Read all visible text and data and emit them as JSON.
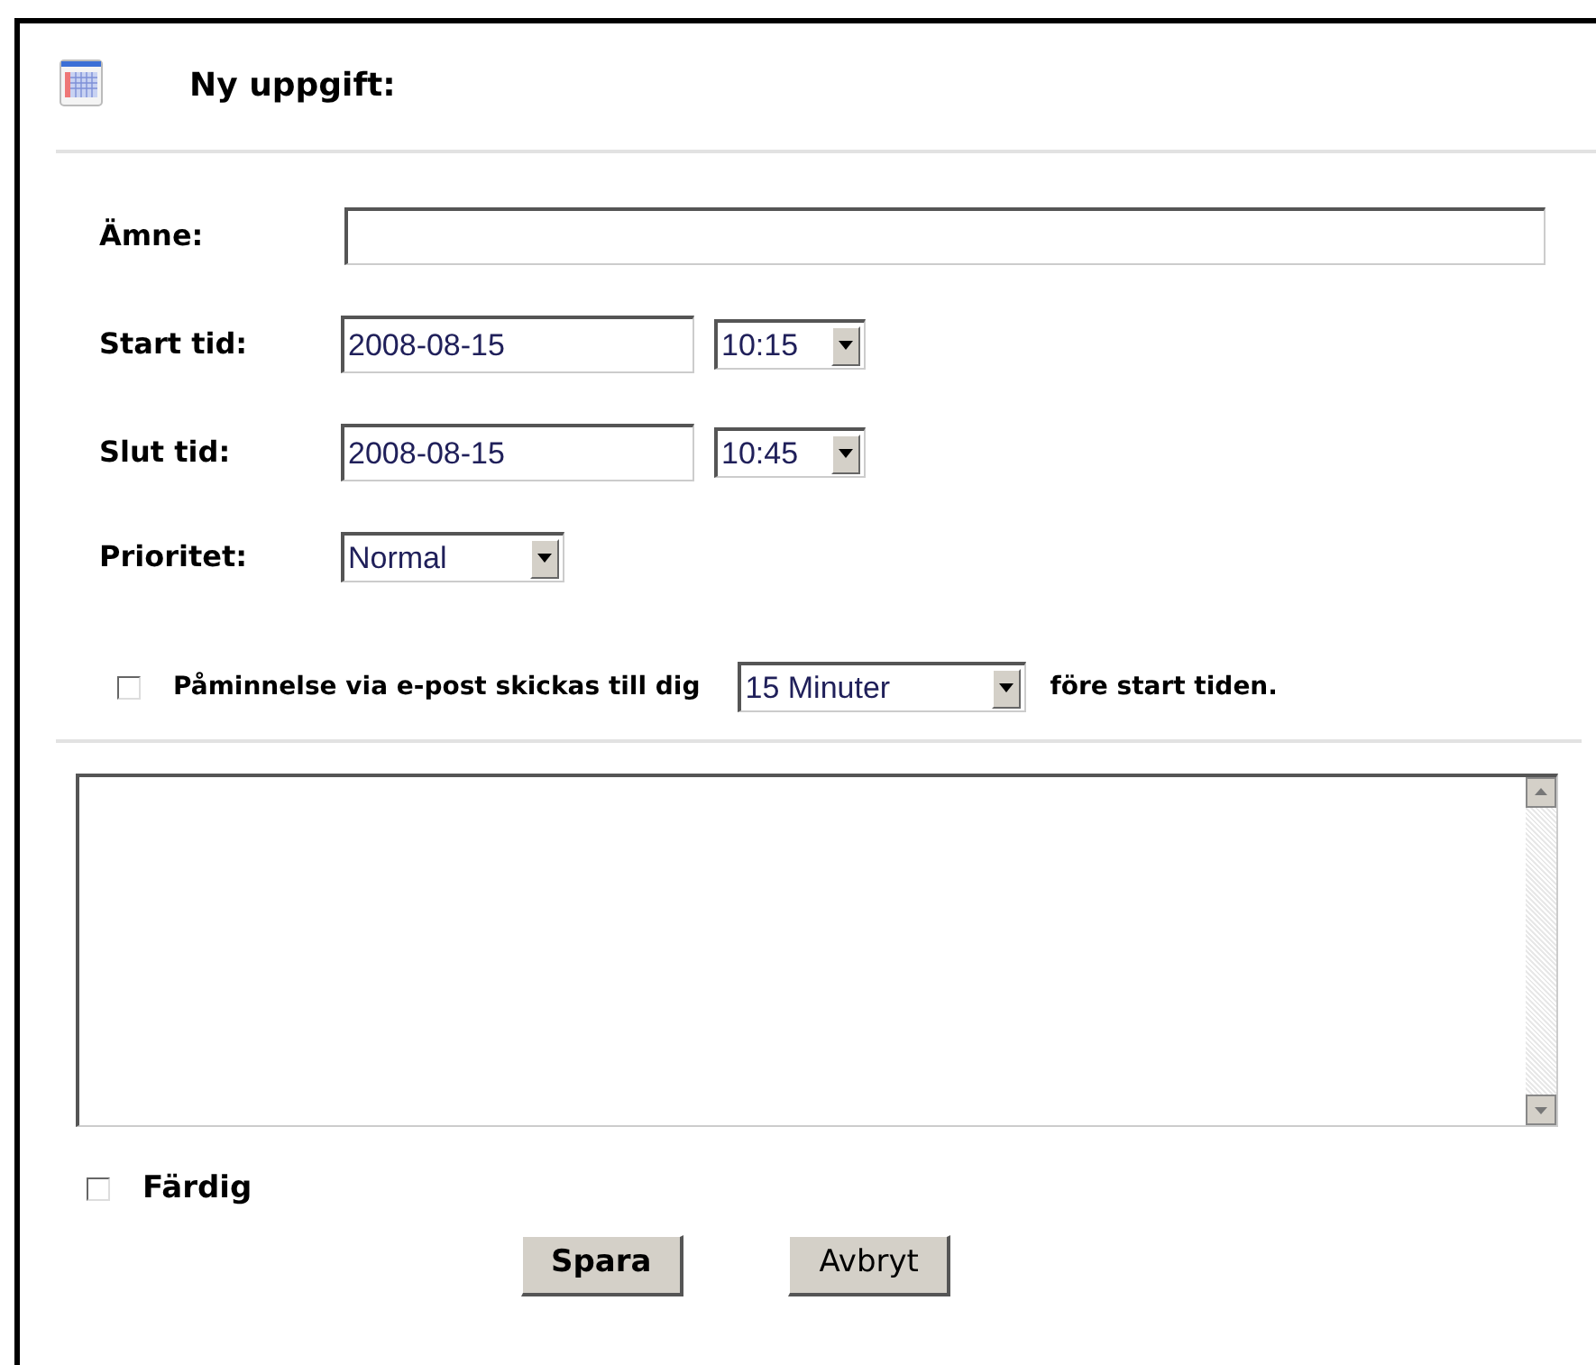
{
  "dialog": {
    "title": "Ny uppgift:"
  },
  "fields": [
    {
      "kind": "text",
      "label": "Ämne:"
    },
    {
      "kind": "datetime",
      "label": "Start tid:",
      "value": "2008-08-15",
      "time": "10:15"
    },
    {
      "kind": "datetime",
      "label": "Slut tid:",
      "value": "2008-08-15",
      "time": "10:45"
    },
    {
      "kind": "select",
      "label": "Prioritet:",
      "value": "Normal"
    }
  ],
  "reminder": {
    "checked": false,
    "label": "Påminnelse via e-post skickas till dig",
    "interval": "15 Minuter",
    "suffix": "före start tiden."
  },
  "done": {
    "checked": false,
    "label": "Färdig"
  },
  "buttons": [
    {
      "label": "Spara",
      "bold": true
    },
    {
      "label": "Avbryt",
      "bold": false
    }
  ]
}
